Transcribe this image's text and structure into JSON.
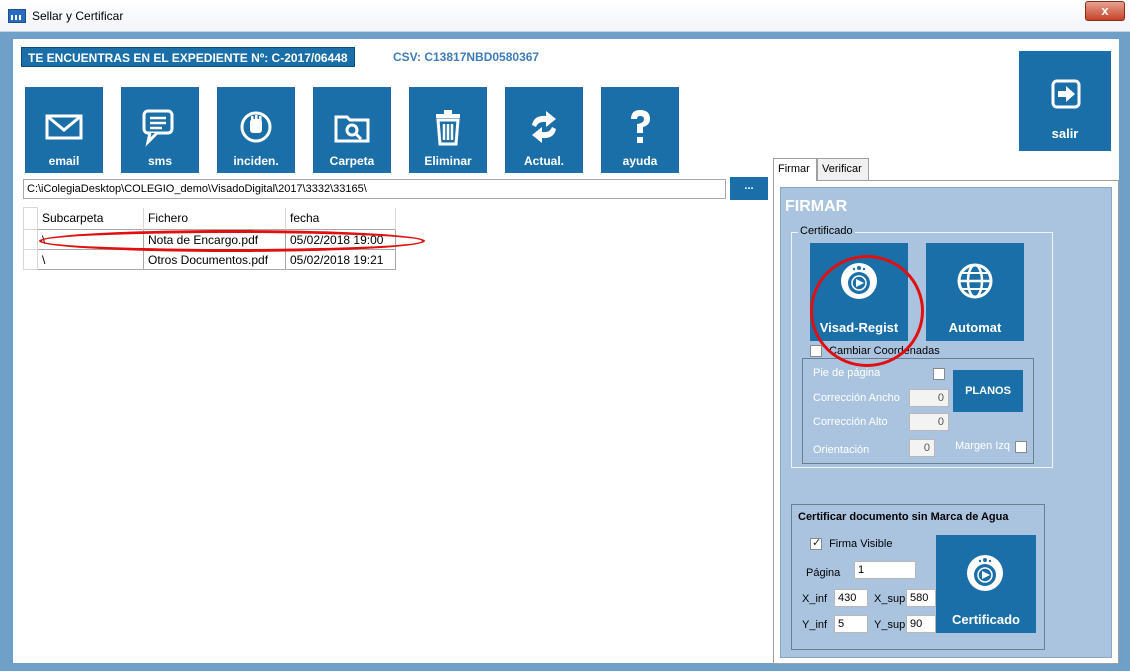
{
  "window": {
    "title": "Sellar y Certificar",
    "close_glyph": "x"
  },
  "header": {
    "expediente": "TE ENCUENTRAS EN EL EXPEDIENTE Nº: C-2017/06448",
    "csv": "CSV: C13817NBD0580367"
  },
  "toolbar": {
    "buttons": [
      {
        "label": "email",
        "icon": "envelope-icon"
      },
      {
        "label": "sms",
        "icon": "chat-icon"
      },
      {
        "label": "inciden.",
        "icon": "hand-icon"
      },
      {
        "label": "Carpeta",
        "icon": "folder-search-icon"
      },
      {
        "label": "Eliminar",
        "icon": "trash-icon"
      },
      {
        "label": "Actual.",
        "icon": "refresh-icon"
      },
      {
        "label": "ayuda",
        "icon": "question-icon"
      }
    ],
    "exit": {
      "label": "salir",
      "icon": "exit-icon"
    }
  },
  "path": {
    "value": "C:\\iColegiaDesktop\\COLEGIO_demo\\VisadoDigital\\2017\\3332\\33165\\",
    "browse_label": "..."
  },
  "files": {
    "columns": [
      "Subcarpeta",
      "Fichero",
      "fecha"
    ],
    "rows": [
      [
        "\\",
        "Nota de Encargo.pdf",
        "05/02/2018 19:00"
      ],
      [
        "\\",
        "Otros Documentos.pdf",
        "05/02/2018 19:21"
      ]
    ]
  },
  "tabs": [
    "Firmar",
    "Verificar"
  ],
  "firmar": {
    "title": "FIRMAR",
    "certificado_group": "Certificado",
    "visad_label": "Visad-Regist",
    "automat_label": "Automat",
    "cambiar_coordenadas": "Cambiar Coordenadas",
    "pie_pagina": "Pie de página",
    "planos_label": "PLANOS",
    "correccion_ancho": "Corrección Ancho",
    "correccion_ancho_value": "0",
    "correccion_alto": "Corrección Alto",
    "correccion_alto_value": "0",
    "orientacion": "Orientación",
    "orientacion_value": "0",
    "margen_izq": "Margen Izq",
    "sin_marca_title": "Certificar documento sin Marca de Agua",
    "firma_visible": "Firma Visible",
    "pagina_label": "Página",
    "pagina_value": "1",
    "x_inf_label": "X_inf",
    "x_inf_value": "430",
    "x_sup_label": "X_sup",
    "x_sup_value": "580",
    "y_inf_label": "Y_inf",
    "y_inf_value": "5",
    "y_sup_label": "Y_sup",
    "y_sup_value": "90",
    "certificado_label": "Certificado"
  },
  "colors": {
    "tile": "#1b6fa8",
    "panel": "#aac4e0",
    "highlight": "#e10f0f"
  }
}
